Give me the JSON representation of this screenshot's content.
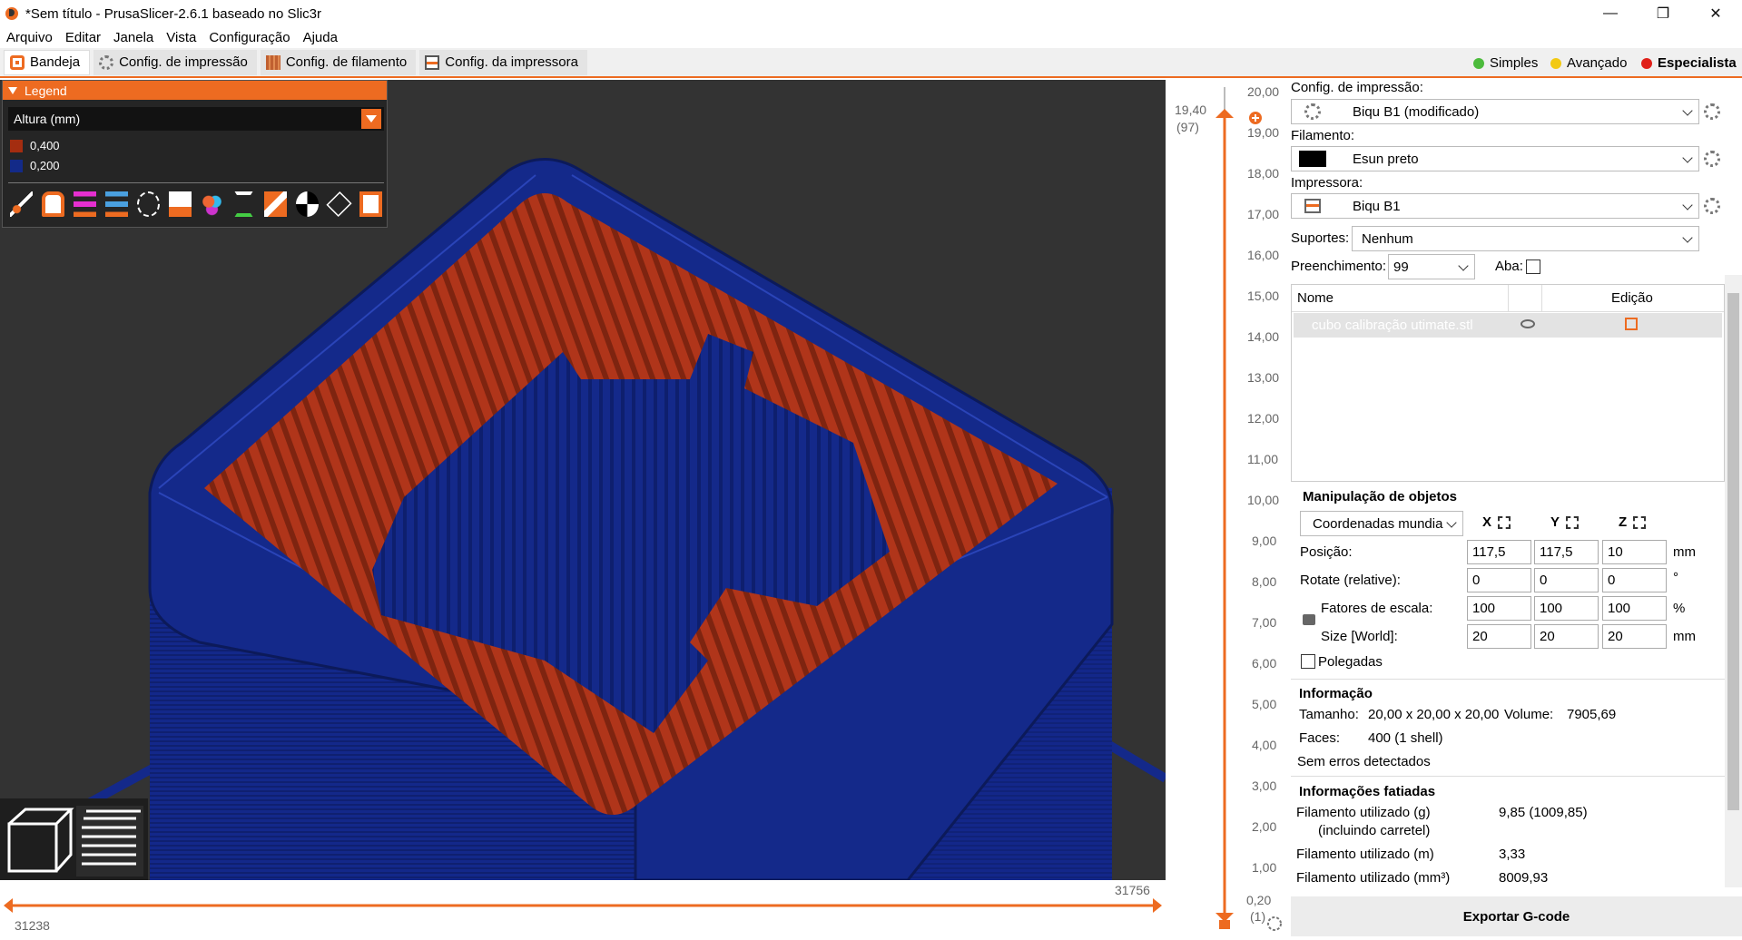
{
  "window": {
    "title": "*Sem título - PrusaSlicer-2.6.1 baseado no Slic3r",
    "min": "—",
    "max": "❐",
    "close": "✕"
  },
  "menu": [
    "Arquivo",
    "Editar",
    "Janela",
    "Vista",
    "Configuração",
    "Ajuda"
  ],
  "tabs": [
    {
      "label": "Bandeja"
    },
    {
      "label": "Config. de impressão"
    },
    {
      "label": "Config. de filamento"
    },
    {
      "label": "Config. da impressora"
    }
  ],
  "modes": [
    {
      "label": "Simples",
      "color": "#4cbb3c"
    },
    {
      "label": "Avançado",
      "color": "#f2c912"
    },
    {
      "label": "Especialista",
      "color": "#e0201a"
    }
  ],
  "legend": {
    "title": "Legend",
    "view_type": "Altura (mm)",
    "items": [
      {
        "label": "0,400",
        "color": "#a42d10"
      },
      {
        "label": "0,200",
        "color": "#132a88"
      }
    ]
  },
  "layer_slider": {
    "top_value": "19,40",
    "top_layer": "(97)",
    "bottom_value": "0,20",
    "bottom_layer": "(1)",
    "ticks": [
      "20,00",
      "19,00",
      "18,00",
      "17,00",
      "16,00",
      "15,00",
      "14,00",
      "13,00",
      "12,00",
      "11,00",
      "10,00",
      "9,00",
      "8,00",
      "7,00",
      "6,00",
      "5,00",
      "4,00",
      "3,00",
      "2,00",
      "1,00"
    ]
  },
  "move_slider": {
    "left_value": "31238",
    "right_value": "31756"
  },
  "right_panel": {
    "print_config_label": "Config. de impressão:",
    "print_config_value": "Biqu B1 (modificado)",
    "filament_label": "Filamento:",
    "filament_value": "Esun preto",
    "filament_color": "#000000",
    "printer_label": "Impressora:",
    "printer_value": "Biqu B1",
    "supports_label": "Suportes:",
    "supports_value": "Nenhum",
    "infill_label": "Preenchimento:",
    "infill_value": "99",
    "brim_label": "Aba:",
    "list_col_name": "Nome",
    "list_col_edit": "Edição",
    "object_name": "cubo calibração utimate.stl"
  },
  "manipulation": {
    "title": "Manipulação de objetos",
    "coords": "Coordenadas mundia",
    "axis_x": "X",
    "axis_y": "Y",
    "axis_z": "Z",
    "position_label": "Posição:",
    "position": [
      "117,5",
      "117,5",
      "10"
    ],
    "position_unit": "mm",
    "rotate_label": "Rotate (relative):",
    "rotate": [
      "0",
      "0",
      "0"
    ],
    "rotate_unit": "°",
    "scale_label": "Fatores de escala:",
    "scale": [
      "100",
      "100",
      "100"
    ],
    "scale_unit": "%",
    "size_label": "Size [World]:",
    "size": [
      "20",
      "20",
      "20"
    ],
    "size_unit": "mm",
    "inches_label": "Polegadas"
  },
  "info": {
    "title": "Informação",
    "size_label": "Tamanho:",
    "size_value": "20,00 x 20,00 x 20,00",
    "volume_label": "Volume:",
    "volume_value": "7905,69",
    "faces_label": "Faces:",
    "faces_value": "400 (1 shell)",
    "errors": "Sem erros detectados"
  },
  "sliced": {
    "title": "Informações fatiadas",
    "g_label": "Filamento utilizado (g)",
    "g_sub": "(incluindo carretel)",
    "g_value": "9,85 (1009,85)",
    "m_label": "Filamento utilizado (m)",
    "m_value": "3,33",
    "mm3_label": "Filamento utilizado (mm³)",
    "mm3_value": "8009,93"
  },
  "export_label": "Exportar G-code"
}
